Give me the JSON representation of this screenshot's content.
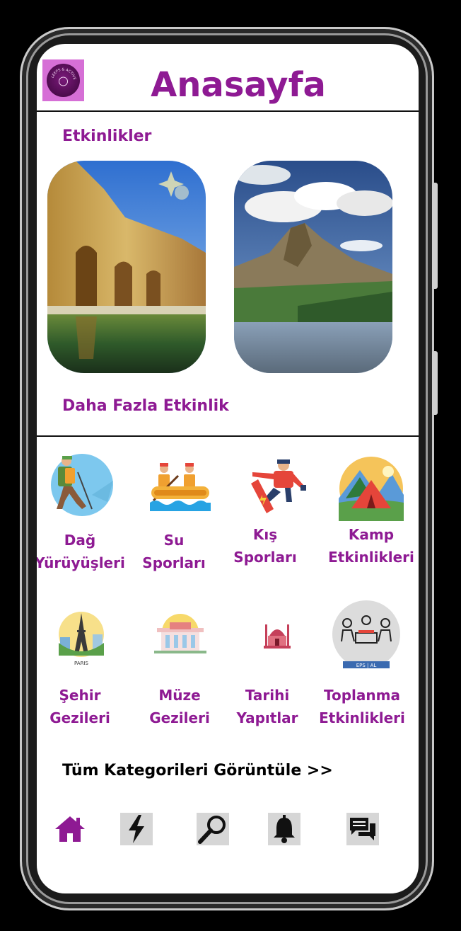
{
  "header": {
    "title": "Anasayfa",
    "logo_text": "LEEPS & ACTIVE CAMPS"
  },
  "events": {
    "section_label": "Etkinlikler",
    "more_label": "Daha Fazla Etkinlik",
    "cards": [
      {
        "image": "canyon-lake-photo"
      },
      {
        "image": "mountain-lake-photo"
      }
    ]
  },
  "categories": {
    "items": [
      {
        "line1": "Dağ",
        "line2": "Yürüyüşleri",
        "icon": "hiker-icon"
      },
      {
        "line1": "Su",
        "line2": "Sporları",
        "icon": "rafting-icon"
      },
      {
        "line1": "Kış",
        "line2": "Sporları",
        "icon": "snowboarder-icon"
      },
      {
        "line1": "Kamp",
        "line2": "Etkinlikleri",
        "icon": "camp-tent-icon"
      },
      {
        "line1": "Şehir",
        "line2": "Gezileri",
        "icon": "paris-city-icon",
        "icon_text": "PARIS"
      },
      {
        "line1": "Müze",
        "line2": "Gezileri",
        "icon": "museum-icon"
      },
      {
        "line1": "Tarihi",
        "line2": "Yapıtlar",
        "icon": "mosque-icon"
      },
      {
        "line1": "Toplanma",
        "line2": "Etkinlikleri",
        "icon": "meeting-icon",
        "icon_text": "EPS | AL"
      }
    ],
    "view_all": "Tüm Kategorileri Görüntüle >>"
  },
  "bottom_nav": {
    "items": [
      "home-icon",
      "lightning-icon",
      "search-icon",
      "bell-icon",
      "chat-icon"
    ],
    "active": "home-icon"
  },
  "colors": {
    "brand": "#8e1a93",
    "background": "#ffffff"
  }
}
